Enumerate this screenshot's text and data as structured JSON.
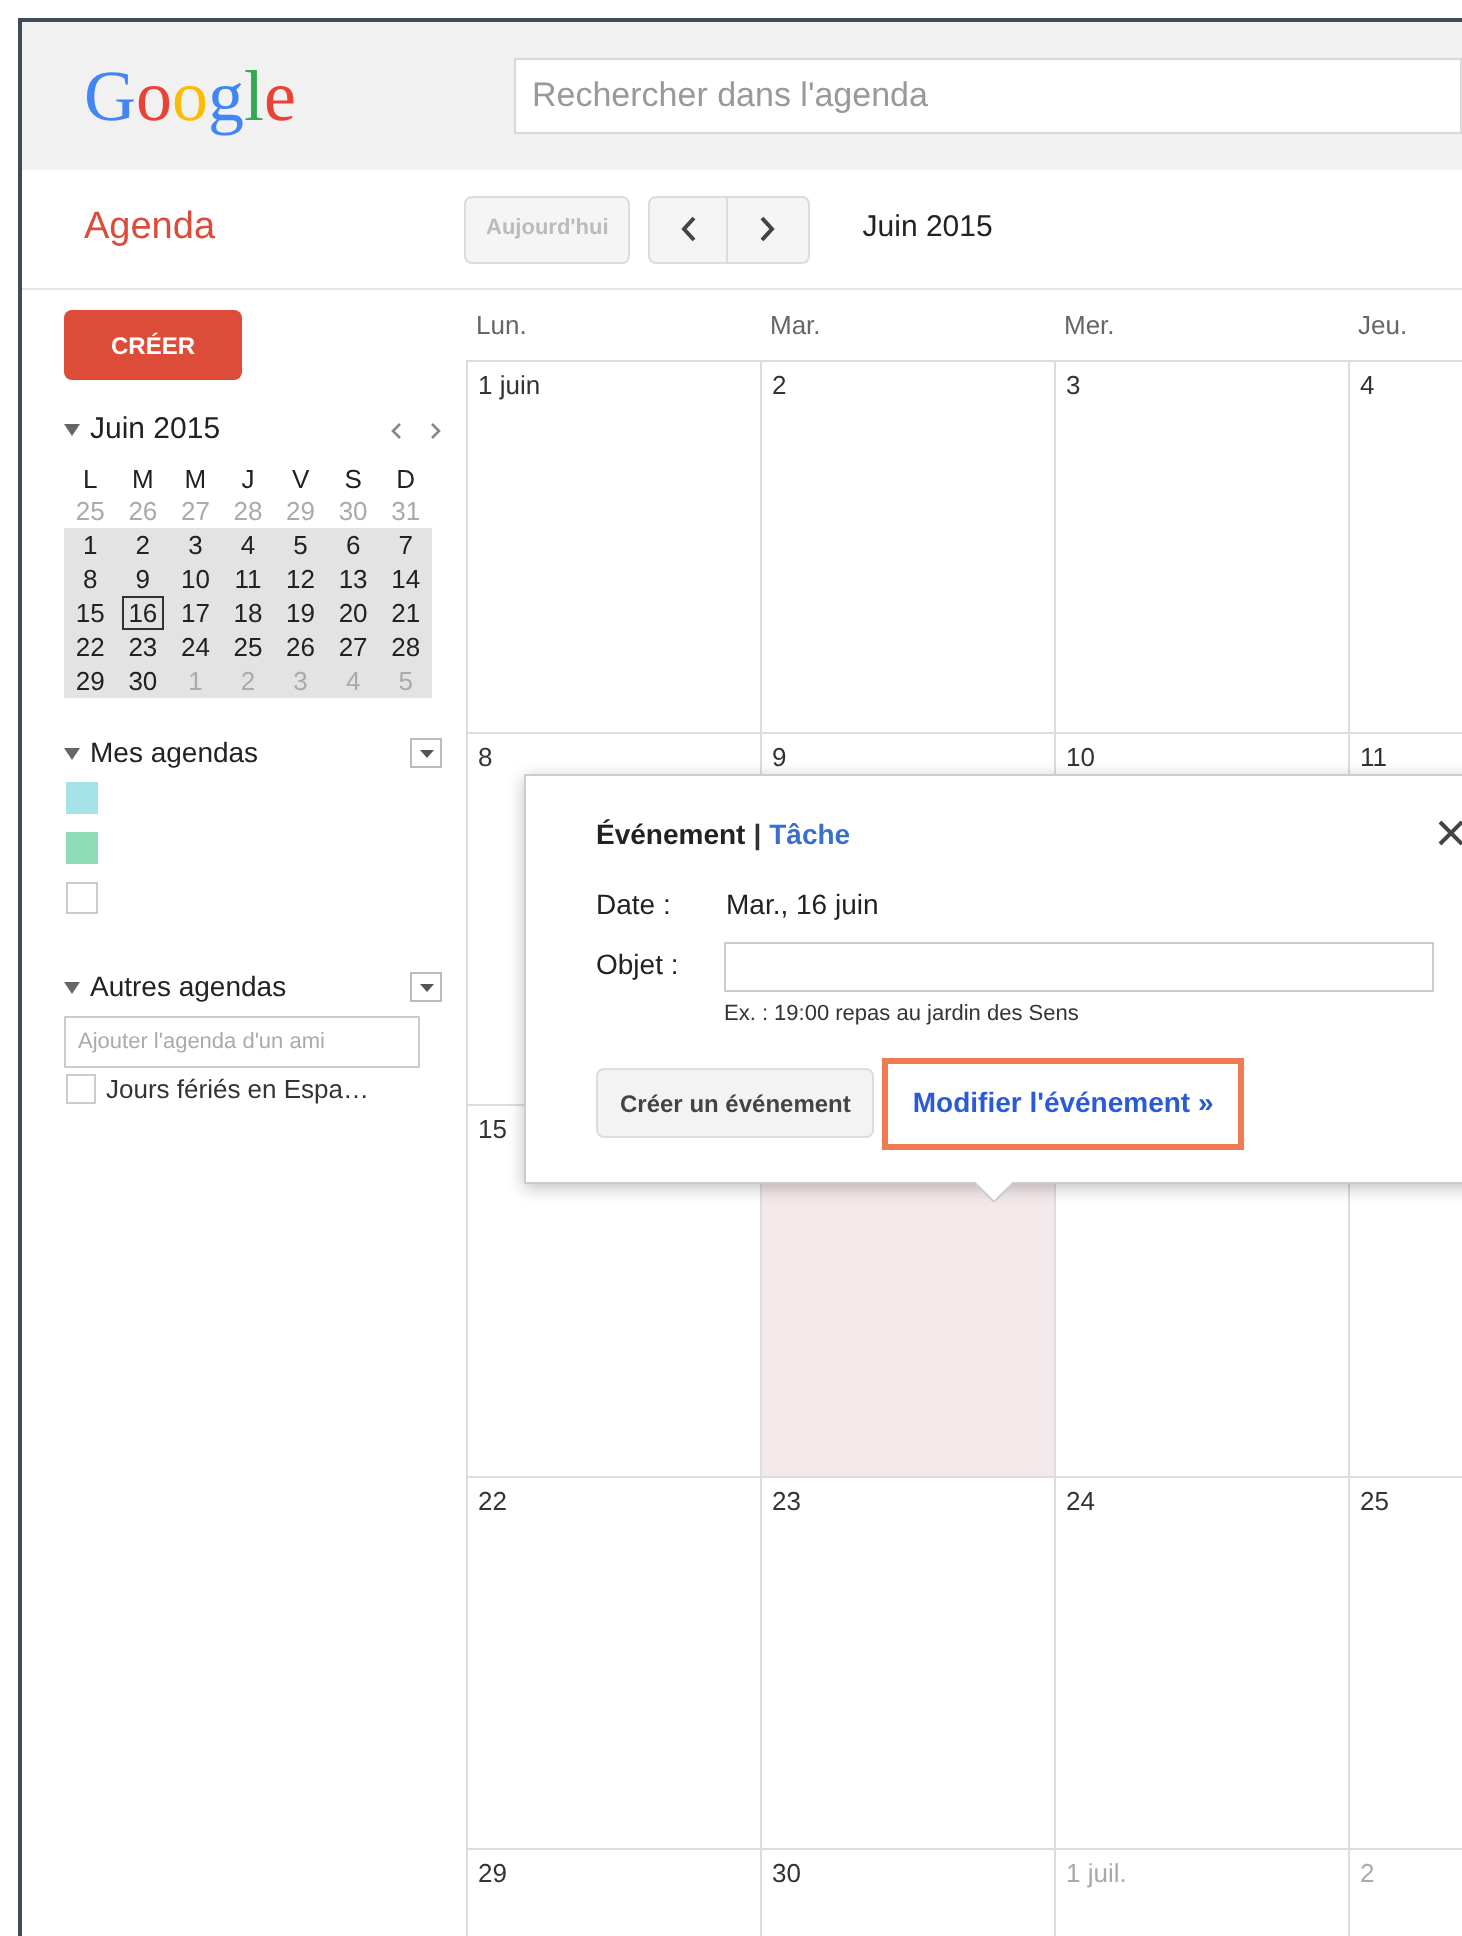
{
  "header": {
    "logo": "Google",
    "search": {
      "placeholder": "Rechercher dans l'agenda"
    }
  },
  "toolbar": {
    "app_title": "Agenda",
    "today_button": {
      "label": "Aujourd'hui",
      "disabled": true
    },
    "period": "Juin 2015"
  },
  "sidebar": {
    "create_button": "CRÉER",
    "mini_calendar": {
      "title": "Juin 2015",
      "expanded": true,
      "weekdays": [
        "L",
        "M",
        "M",
        "J",
        "V",
        "S",
        "D"
      ],
      "weeks": [
        {
          "in_view": false,
          "days": [
            {
              "day": "25",
              "other_month": true,
              "selected": false
            },
            {
              "day": "26",
              "other_month": true,
              "selected": false
            },
            {
              "day": "27",
              "other_month": true,
              "selected": false
            },
            {
              "day": "28",
              "other_month": true,
              "selected": false
            },
            {
              "day": "29",
              "other_month": true,
              "selected": false
            },
            {
              "day": "30",
              "other_month": true,
              "selected": false
            },
            {
              "day": "31",
              "other_month": true,
              "selected": false
            }
          ]
        },
        {
          "in_view": true,
          "days": [
            {
              "day": "1",
              "other_month": false,
              "selected": false
            },
            {
              "day": "2",
              "other_month": false,
              "selected": false
            },
            {
              "day": "3",
              "other_month": false,
              "selected": false
            },
            {
              "day": "4",
              "other_month": false,
              "selected": false
            },
            {
              "day": "5",
              "other_month": false,
              "selected": false
            },
            {
              "day": "6",
              "other_month": false,
              "selected": false
            },
            {
              "day": "7",
              "other_month": false,
              "selected": false
            }
          ]
        },
        {
          "in_view": true,
          "days": [
            {
              "day": "8",
              "other_month": false,
              "selected": false
            },
            {
              "day": "9",
              "other_month": false,
              "selected": false
            },
            {
              "day": "10",
              "other_month": false,
              "selected": false
            },
            {
              "day": "11",
              "other_month": false,
              "selected": false
            },
            {
              "day": "12",
              "other_month": false,
              "selected": false
            },
            {
              "day": "13",
              "other_month": false,
              "selected": false
            },
            {
              "day": "14",
              "other_month": false,
              "selected": false
            }
          ]
        },
        {
          "in_view": true,
          "days": [
            {
              "day": "15",
              "other_month": false,
              "selected": false
            },
            {
              "day": "16",
              "other_month": false,
              "selected": true
            },
            {
              "day": "17",
              "other_month": false,
              "selected": false
            },
            {
              "day": "18",
              "other_month": false,
              "selected": false
            },
            {
              "day": "19",
              "other_month": false,
              "selected": false
            },
            {
              "day": "20",
              "other_month": false,
              "selected": false
            },
            {
              "day": "21",
              "other_month": false,
              "selected": false
            }
          ]
        },
        {
          "in_view": true,
          "days": [
            {
              "day": "22",
              "other_month": false,
              "selected": false
            },
            {
              "day": "23",
              "other_month": false,
              "selected": false
            },
            {
              "day": "24",
              "other_month": false,
              "selected": false
            },
            {
              "day": "25",
              "other_month": false,
              "selected": false
            },
            {
              "day": "26",
              "other_month": false,
              "selected": false
            },
            {
              "day": "27",
              "other_month": false,
              "selected": false
            },
            {
              "day": "28",
              "other_month": false,
              "selected": false
            }
          ]
        },
        {
          "in_view": true,
          "days": [
            {
              "day": "29",
              "other_month": false,
              "selected": false
            },
            {
              "day": "30",
              "other_month": false,
              "selected": false
            },
            {
              "day": "1",
              "other_month": true,
              "selected": false
            },
            {
              "day": "2",
              "other_month": true,
              "selected": false
            },
            {
              "day": "3",
              "other_month": true,
              "selected": false
            },
            {
              "day": "4",
              "other_month": true,
              "selected": false
            },
            {
              "day": "5",
              "other_month": true,
              "selected": false
            }
          ]
        }
      ]
    },
    "my_calendars": {
      "title": "Mes agendas",
      "expanded": true,
      "items": [
        {
          "checked": true,
          "color": "#a4e2e7"
        },
        {
          "checked": true,
          "color": "#8fdcb8"
        },
        {
          "checked": false
        }
      ]
    },
    "other_calendars": {
      "title": "Autres agendas",
      "expanded": true,
      "add_field": {
        "placeholder": "Ajouter l'agenda d'un ami"
      },
      "items": [
        {
          "label": "Jours fériés en Espa…",
          "checked": false
        }
      ]
    }
  },
  "calendar": {
    "weekdays": [
      "Lun.",
      "Mar.",
      "Mer.",
      "Jeu."
    ],
    "weeks": [
      [
        {
          "label": "1 juin",
          "other_month": false,
          "selected": false
        },
        {
          "label": "2",
          "other_month": false,
          "selected": false
        },
        {
          "label": "3",
          "other_month": false,
          "selected": false
        },
        {
          "label": "4",
          "other_month": false,
          "selected": false
        }
      ],
      [
        {
          "label": "8",
          "other_month": false,
          "selected": false
        },
        {
          "label": "9",
          "other_month": false,
          "selected": false
        },
        {
          "label": "10",
          "other_month": false,
          "selected": false
        },
        {
          "label": "11",
          "other_month": false,
          "selected": false
        }
      ],
      [
        {
          "label": "15",
          "other_month": false,
          "selected": false
        },
        {
          "selected": true
        },
        {
          "selected": false
        },
        {
          "selected": false
        }
      ],
      [
        {
          "label": "22",
          "other_month": false,
          "selected": false
        },
        {
          "label": "23",
          "other_month": false,
          "selected": false
        },
        {
          "label": "24",
          "other_month": false,
          "selected": false
        },
        {
          "label": "25",
          "other_month": false,
          "selected": false
        }
      ],
      [
        {
          "label": "29",
          "other_month": false,
          "selected": false
        },
        {
          "label": "30",
          "other_month": false,
          "selected": false
        },
        {
          "label": "1 juil.",
          "other_month": true,
          "selected": false
        },
        {
          "label": "2",
          "other_month": true,
          "selected": false
        }
      ]
    ]
  },
  "popup": {
    "tabs": [
      {
        "label": "Événement",
        "selected": true
      },
      {
        "label": "Tâche",
        "selected": false
      }
    ],
    "separator": "|",
    "date_label": "Date :",
    "date_value": "Mar., 16 juin",
    "subject_label": "Objet :",
    "subject_hint": "Ex. : 19:00 repas au jardin des Sens",
    "create_button": "Créer un événement",
    "edit_link": {
      "label": "Modifier l'événement »",
      "highlighted": true
    }
  }
}
